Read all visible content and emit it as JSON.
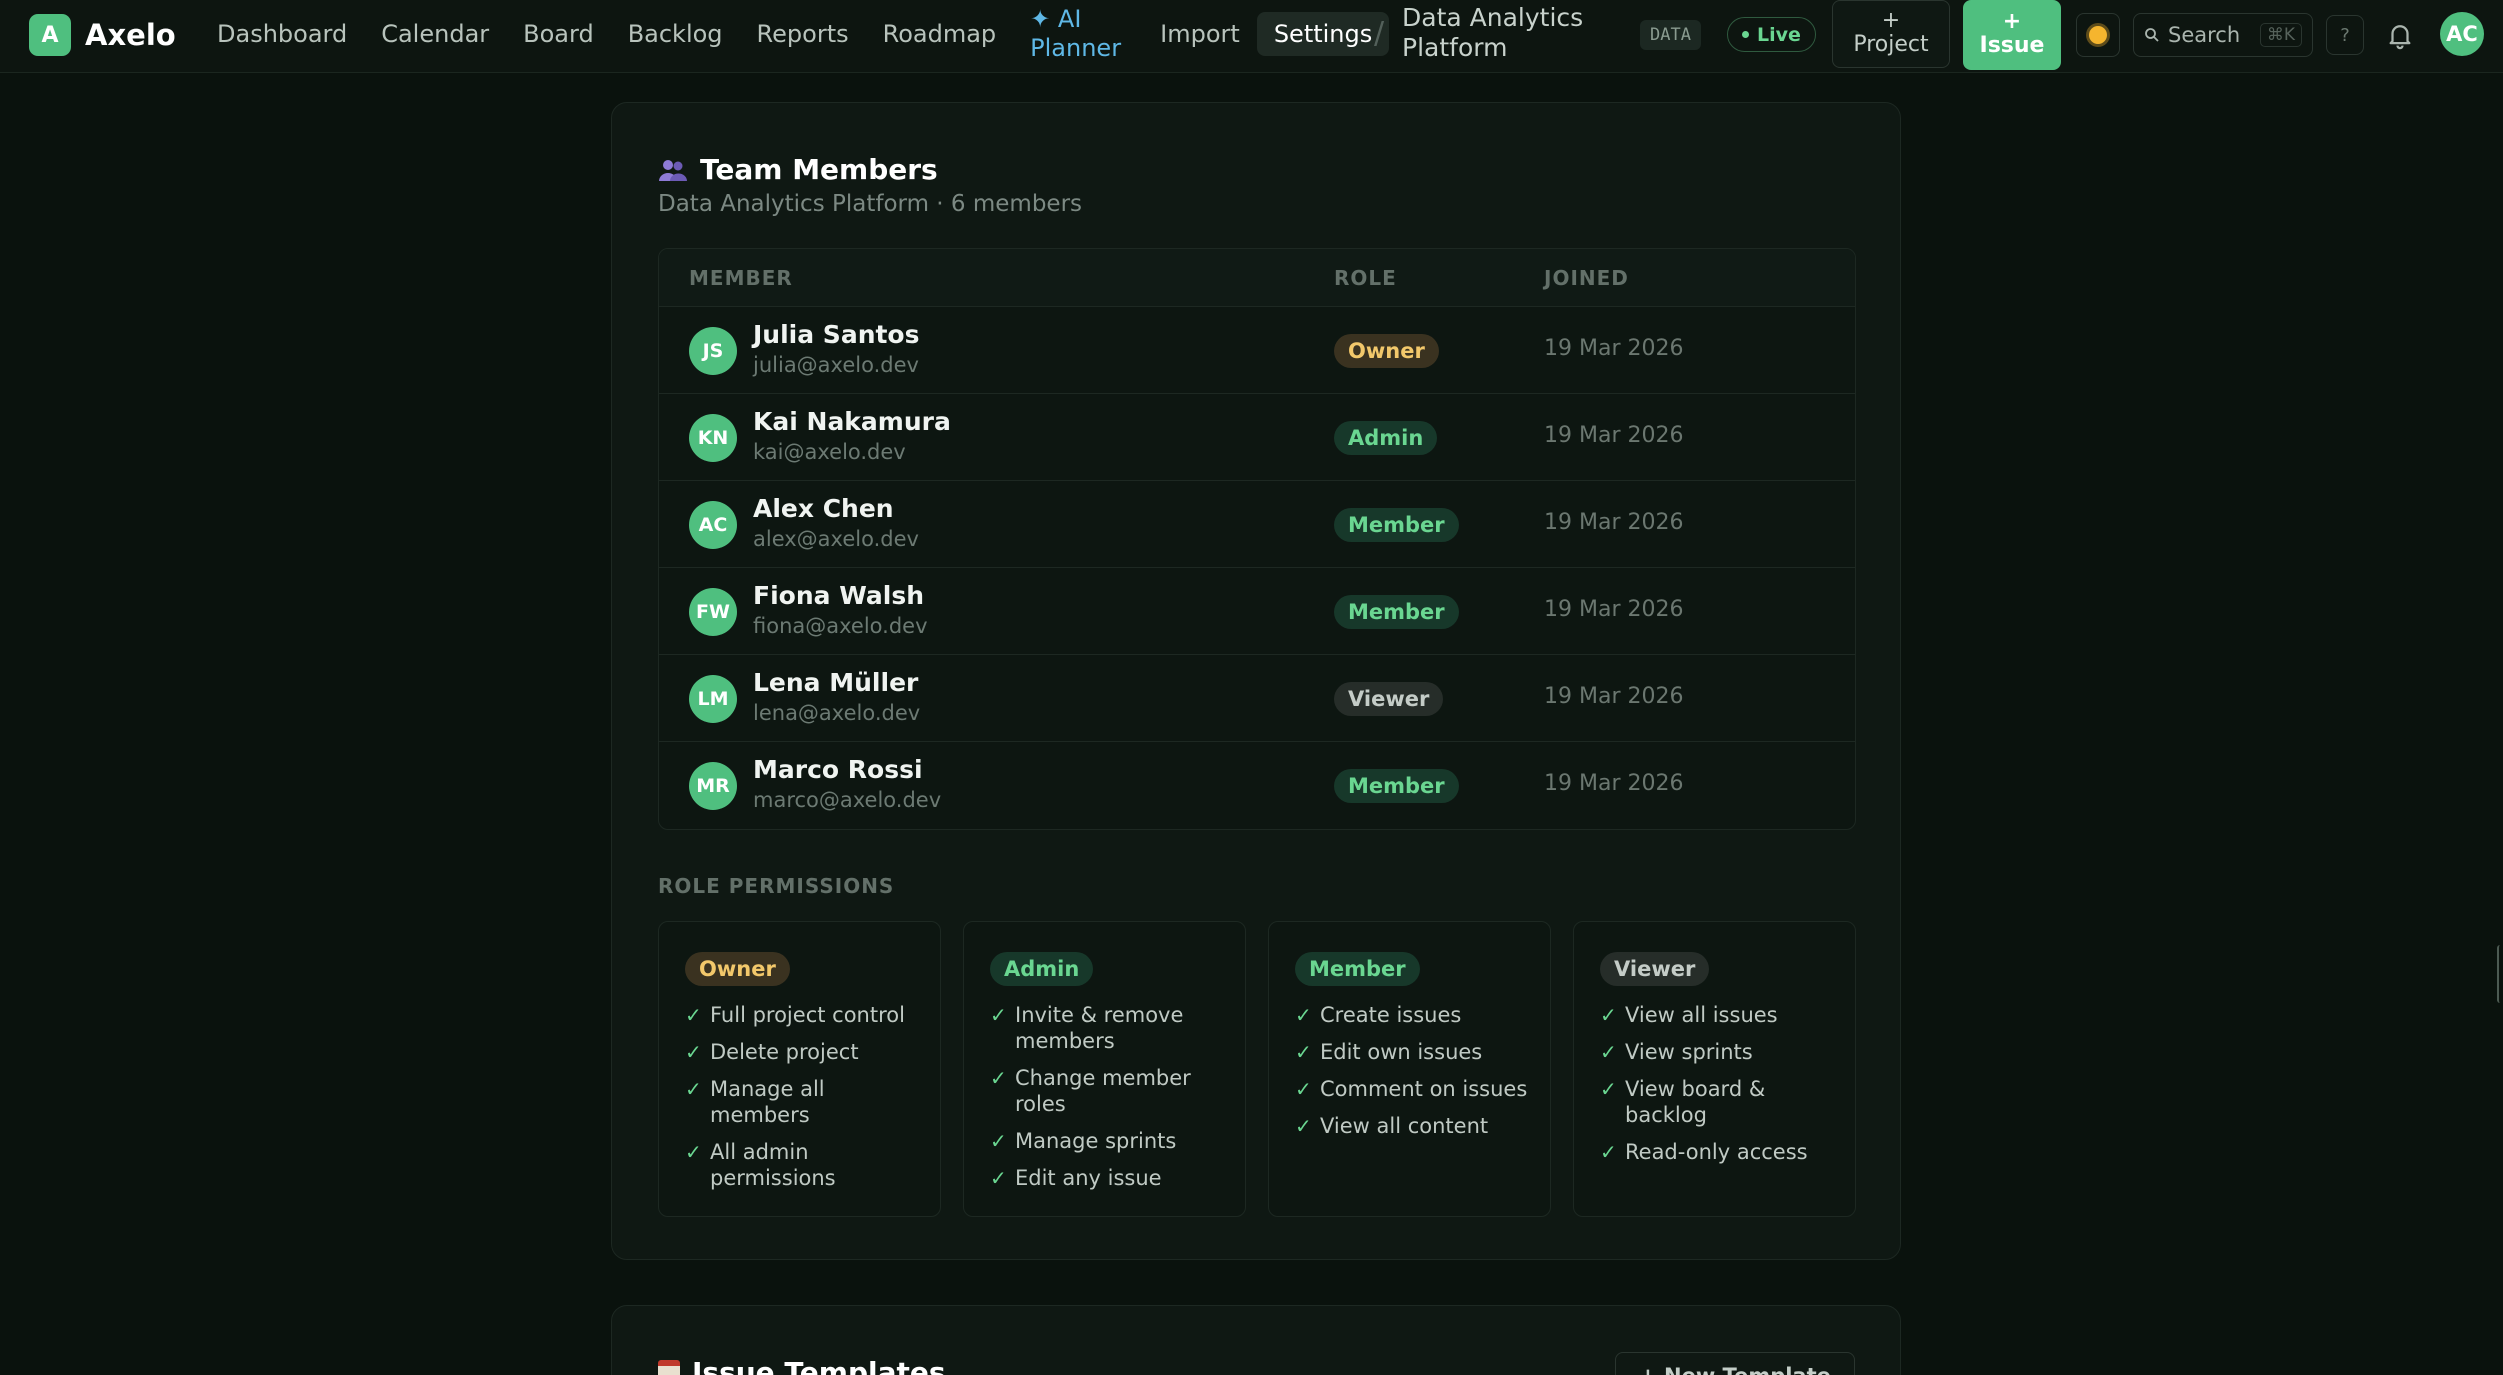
{
  "app": {
    "logo_letter": "A",
    "name": "Axelo"
  },
  "nav": {
    "items": [
      {
        "label": "Dashboard"
      },
      {
        "label": "Calendar"
      },
      {
        "label": "Board"
      },
      {
        "label": "Backlog"
      },
      {
        "label": "Reports"
      },
      {
        "label": "Roadmap"
      },
      {
        "label": "✦ AI Planner"
      },
      {
        "label": "Import"
      },
      {
        "label": "Settings"
      }
    ],
    "active": "Settings"
  },
  "breadcrumb": {
    "separator": "/",
    "project": "Data Analytics Platform",
    "key": "DATA",
    "live": "Live"
  },
  "actions": {
    "project_plus": "+",
    "project_label": "Project",
    "issue_plus": "+",
    "issue_label": "Issue",
    "search_label": "Search",
    "search_shortcut": "⌘K",
    "help": "?",
    "user_initials": "AC"
  },
  "team": {
    "title": "Team Members",
    "subtitle": "Data Analytics Platform · 6 members",
    "columns": {
      "member": "MEMBER",
      "role": "ROLE",
      "joined": "JOINED"
    },
    "members": [
      {
        "initials": "JS",
        "name": "Julia Santos",
        "email": "julia@axelo.dev",
        "role": "Owner",
        "joined": "19 Mar 2026"
      },
      {
        "initials": "KN",
        "name": "Kai Nakamura",
        "email": "kai@axelo.dev",
        "role": "Admin",
        "joined": "19 Mar 2026"
      },
      {
        "initials": "AC",
        "name": "Alex Chen",
        "email": "alex@axelo.dev",
        "role": "Member",
        "joined": "19 Mar 2026"
      },
      {
        "initials": "FW",
        "name": "Fiona Walsh",
        "email": "fiona@axelo.dev",
        "role": "Member",
        "joined": "19 Mar 2026"
      },
      {
        "initials": "LM",
        "name": "Lena Müller",
        "email": "lena@axelo.dev",
        "role": "Viewer",
        "joined": "19 Mar 2026"
      },
      {
        "initials": "MR",
        "name": "Marco Rossi",
        "email": "marco@axelo.dev",
        "role": "Member",
        "joined": "19 Mar 2026"
      }
    ]
  },
  "permissions": {
    "title": "ROLE PERMISSIONS",
    "check": "✓",
    "roles": [
      {
        "name": "Owner",
        "items": [
          "Full project control",
          "Delete project",
          "Manage all members",
          "All admin permissions"
        ]
      },
      {
        "name": "Admin",
        "items": [
          "Invite & remove members",
          "Change member roles",
          "Manage sprints",
          "Edit any issue"
        ]
      },
      {
        "name": "Member",
        "items": [
          "Create issues",
          "Edit own issues",
          "Comment on issues",
          "View all content"
        ]
      },
      {
        "name": "Viewer",
        "items": [
          "View all issues",
          "View sprints",
          "View board & backlog",
          "Read-only access"
        ]
      }
    ]
  },
  "templates": {
    "title": "Issue Templates",
    "new_button": "+ New Template"
  },
  "colors": {
    "accent": "#4fbf7f",
    "background": "#0a120d",
    "owner_badge": "#f2c86b",
    "member_badge": "#6ad691",
    "ai_link": "#5fb8e6"
  },
  "icons": [
    "team-icon",
    "sun-icon",
    "search-icon",
    "bell-icon",
    "check-icon",
    "template-icon"
  ]
}
